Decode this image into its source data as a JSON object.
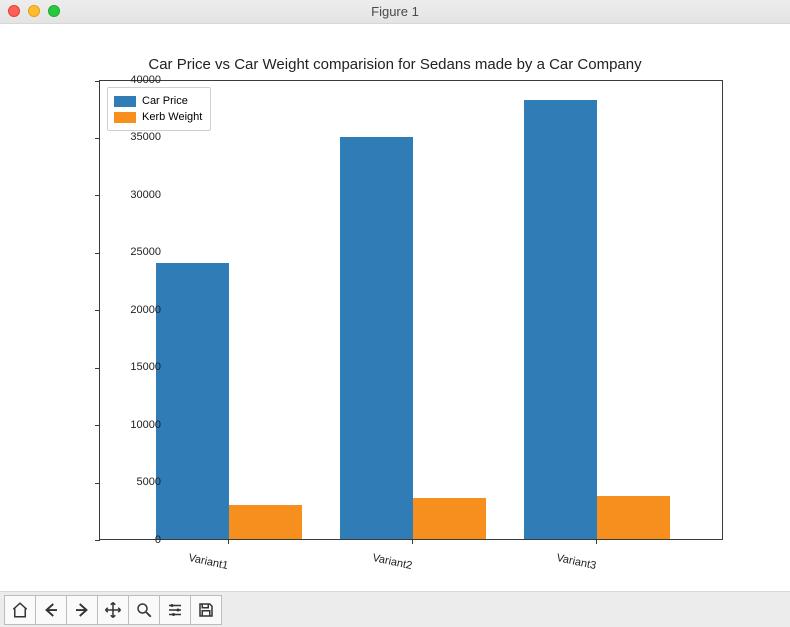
{
  "window_title": "Figure 1",
  "chart_data": {
    "type": "bar",
    "title": "Car Price vs Car Weight comparision for Sedans made by a Car Company",
    "categories": [
      "Variant1",
      "Variant2",
      "Variant3"
    ],
    "series": [
      {
        "name": "Car Price",
        "values": [
          24000,
          35000,
          38200
        ],
        "color": "#2f7cb6"
      },
      {
        "name": "Kerb Weight",
        "values": [
          3000,
          3600,
          3700
        ],
        "color": "#f68f1e"
      }
    ],
    "xlabel": "",
    "ylabel": "",
    "ylim": [
      0,
      40000
    ],
    "yticks": [
      0,
      5000,
      10000,
      15000,
      20000,
      25000,
      30000,
      35000,
      40000
    ]
  },
  "legend": {
    "items": [
      {
        "label": "Car Price"
      },
      {
        "label": "Kerb Weight"
      }
    ]
  },
  "toolbar": {
    "home": "Home",
    "back": "Back",
    "forward": "Forward",
    "pan": "Pan",
    "zoom": "Zoom",
    "configure": "Configure",
    "save": "Save"
  }
}
